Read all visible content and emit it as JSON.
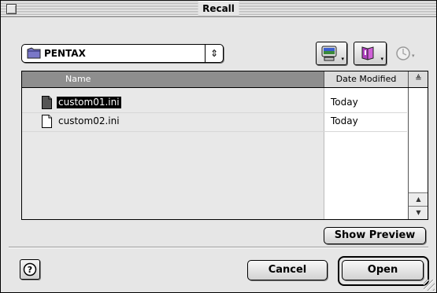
{
  "window": {
    "title": "Recall"
  },
  "location": {
    "label": "PENTAX",
    "popup_arrow": "⇕"
  },
  "toolbar": {
    "icons": [
      "desktop-icon",
      "favorites-icon",
      "recent-icon"
    ]
  },
  "file_list": {
    "columns": [
      "Name",
      "Date Modified"
    ],
    "sort_glyph": "≜",
    "rows": [
      {
        "name": "custom01.ini",
        "date": "Today",
        "selected": true
      },
      {
        "name": "custom02.ini",
        "date": "Today",
        "selected": false
      }
    ]
  },
  "buttons": {
    "show_preview": "Show Preview",
    "cancel": "Cancel",
    "open": "Open",
    "help": "?"
  }
}
